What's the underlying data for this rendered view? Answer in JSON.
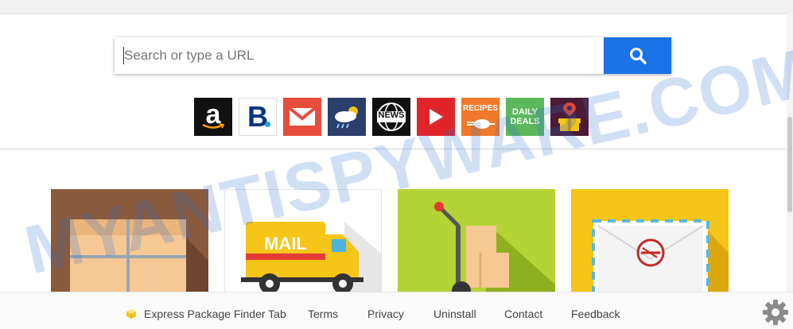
{
  "search": {
    "placeholder": "Search or type a URL",
    "button_icon": "search-icon"
  },
  "quicklinks": [
    {
      "name": "amazon",
      "icon": "amazon-icon",
      "label": "a"
    },
    {
      "name": "booking",
      "icon": "booking-icon",
      "label": "B"
    },
    {
      "name": "gmail",
      "icon": "mail-icon"
    },
    {
      "name": "weather",
      "icon": "weather-icon"
    },
    {
      "name": "news",
      "icon": "news-icon",
      "label": "NEWS"
    },
    {
      "name": "video",
      "icon": "play-icon"
    },
    {
      "name": "recipes",
      "icon": "recipes-icon",
      "label": "RECIPES"
    },
    {
      "name": "deals",
      "icon": "deals-icon",
      "label_line1": "DAILY",
      "label_line2": "DEALS"
    },
    {
      "name": "gift",
      "icon": "gift-icon"
    }
  ],
  "cards": [
    {
      "name": "package-card",
      "icon": "package-icon"
    },
    {
      "name": "mail-truck-card",
      "icon": "mail-truck-icon",
      "label": "MAIL"
    },
    {
      "name": "hand-truck-card",
      "icon": "hand-truck-icon"
    },
    {
      "name": "envelope-card",
      "icon": "envelope-icon"
    }
  ],
  "footer": {
    "brand": "Express Package Finder Tab",
    "links": {
      "terms": "Terms",
      "privacy": "Privacy",
      "uninstall": "Uninstall",
      "contact": "Contact",
      "feedback": "Feedback"
    },
    "settings_icon": "gear-icon"
  },
  "watermark": "MYANTISPYWARE.COM",
  "colors": {
    "search_button": "#1a73e8",
    "watermark": "#2f6fd0"
  }
}
